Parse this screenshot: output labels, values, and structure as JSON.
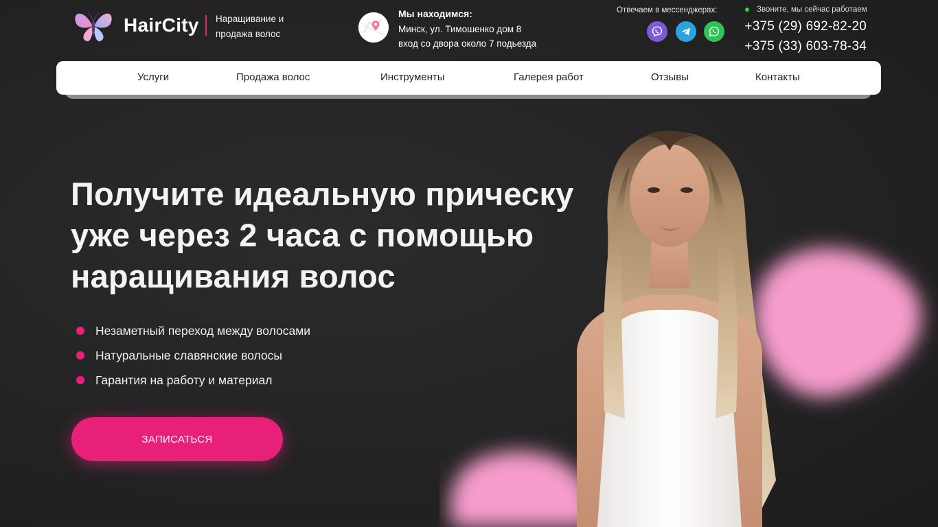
{
  "header": {
    "brand": "HairCity",
    "tagline_line1": "Наращивание и",
    "tagline_line2": "продажа волос",
    "location_title": "Мы находимся:",
    "location_line1": "Минск, ул. Тимошенко дом 8",
    "location_line2": "вход со двора около 7 подьезда",
    "messengers_label": "Отвечаем в мессенджерах:",
    "messengers": [
      "viber-icon",
      "telegram-icon",
      "whatsapp-icon"
    ],
    "status": "Звоните, мы сейчас работаем",
    "phone_1": "+375 (29) 692-82-20",
    "phone_2": "+375 (33) 603-78-34"
  },
  "nav": {
    "items": [
      {
        "label": "Услуги"
      },
      {
        "label": "Продажа волос"
      },
      {
        "label": "Инструменты"
      },
      {
        "label": "Галерея работ"
      },
      {
        "label": "Отзывы"
      },
      {
        "label": "Контакты"
      }
    ]
  },
  "hero": {
    "title_line1": "Получите идеальную прическу",
    "title_line2": "уже через 2 часа с помощью",
    "title_line3": "наращивания волос",
    "features": [
      "Незаметный переход между волосами",
      "Натуральные славянские волосы",
      "Гарантия на работу и материал"
    ],
    "cta": "ЗАПИСАТЬСЯ"
  },
  "colors": {
    "accent": "#e8207a",
    "background": "#242324",
    "status_online": "#36d23a",
    "viber": "#7b5bd6",
    "telegram": "#2aa3df",
    "whatsapp": "#2fc45a"
  }
}
